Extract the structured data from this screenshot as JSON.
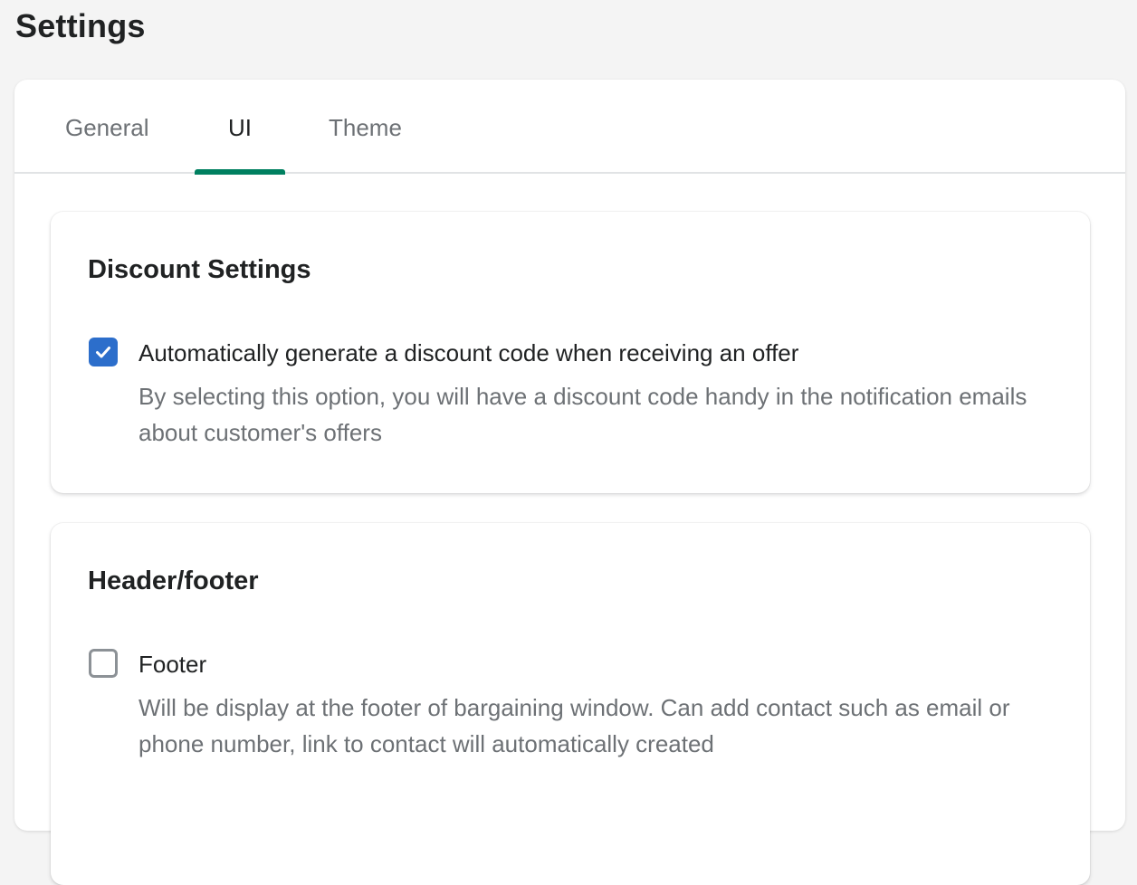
{
  "page": {
    "title": "Settings"
  },
  "tabs": [
    {
      "label": "General",
      "active": false
    },
    {
      "label": "UI",
      "active": true
    },
    {
      "label": "Theme",
      "active": false
    }
  ],
  "colors": {
    "accent_tab": "#008060",
    "checkbox_checked": "#2c6ecb",
    "text_primary": "#202223",
    "text_subdued": "#6d7175"
  },
  "sections": {
    "discount": {
      "title": "Discount Settings",
      "option": {
        "label": "Automatically generate a discount code when receiving an offer",
        "help": "By selecting this option, you will have a discount code handy in the notification emails about customer's offers",
        "checked": true,
        "icon": "checkmark-icon"
      }
    },
    "header_footer": {
      "title": "Header/footer",
      "option": {
        "label": "Footer",
        "help": "Will be display at the footer of bargaining window. Can add contact such as email or phone number, link to contact will automatically created",
        "checked": false
      }
    }
  }
}
